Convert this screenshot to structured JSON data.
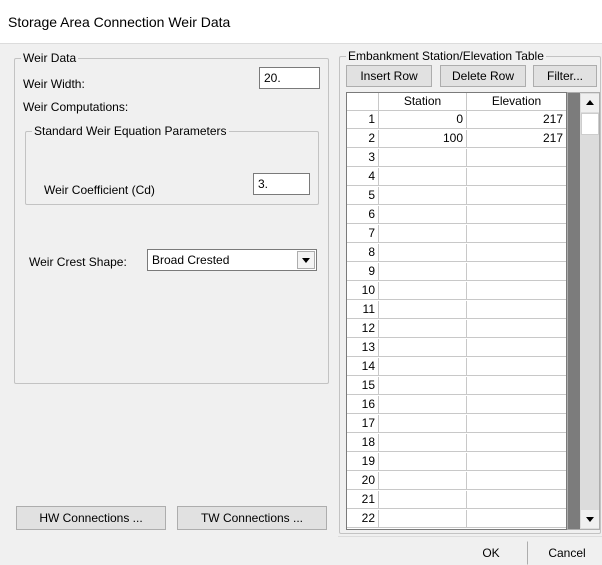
{
  "window": {
    "title": "Storage Area Connection Weir Data"
  },
  "weir_data": {
    "legend": "Weir Data",
    "width_label": "Weir Width:",
    "width_value": "20.",
    "computations_label": "Weir Computations:",
    "standard": {
      "legend": "Standard Weir Equation Parameters",
      "coef_label": "Weir Coefficient (Cd)",
      "coef_value": "3."
    },
    "crest_label": "Weir Crest Shape:",
    "crest_value": "Broad Crested"
  },
  "buttons": {
    "hw": "HW Connections ...",
    "tw": "TW Connections ...",
    "ok": "OK",
    "cancel": "Cancel"
  },
  "table": {
    "legend": "Embankment Station/Elevation Table",
    "insert_row": "Insert Row",
    "delete_row": "Delete Row",
    "filter": "Filter...",
    "columns": [
      "Station",
      "Elevation"
    ],
    "rows": [
      [
        "1",
        "0",
        "217"
      ],
      [
        "2",
        "100",
        "217"
      ],
      [
        "3",
        "",
        ""
      ],
      [
        "4",
        "",
        ""
      ],
      [
        "5",
        "",
        ""
      ],
      [
        "6",
        "",
        ""
      ],
      [
        "7",
        "",
        ""
      ],
      [
        "8",
        "",
        ""
      ],
      [
        "9",
        "",
        ""
      ],
      [
        "10",
        "",
        ""
      ],
      [
        "11",
        "",
        ""
      ],
      [
        "12",
        "",
        ""
      ],
      [
        "13",
        "",
        ""
      ],
      [
        "14",
        "",
        ""
      ],
      [
        "15",
        "",
        ""
      ],
      [
        "16",
        "",
        ""
      ],
      [
        "17",
        "",
        ""
      ],
      [
        "18",
        "",
        ""
      ],
      [
        "19",
        "",
        ""
      ],
      [
        "20",
        "",
        ""
      ],
      [
        "21",
        "",
        ""
      ],
      [
        "22",
        "",
        ""
      ]
    ]
  },
  "icons": {
    "dropdown": "chevron-down-icon",
    "scroll_up": "arrow-up-icon",
    "scroll_down": "arrow-down-icon"
  }
}
